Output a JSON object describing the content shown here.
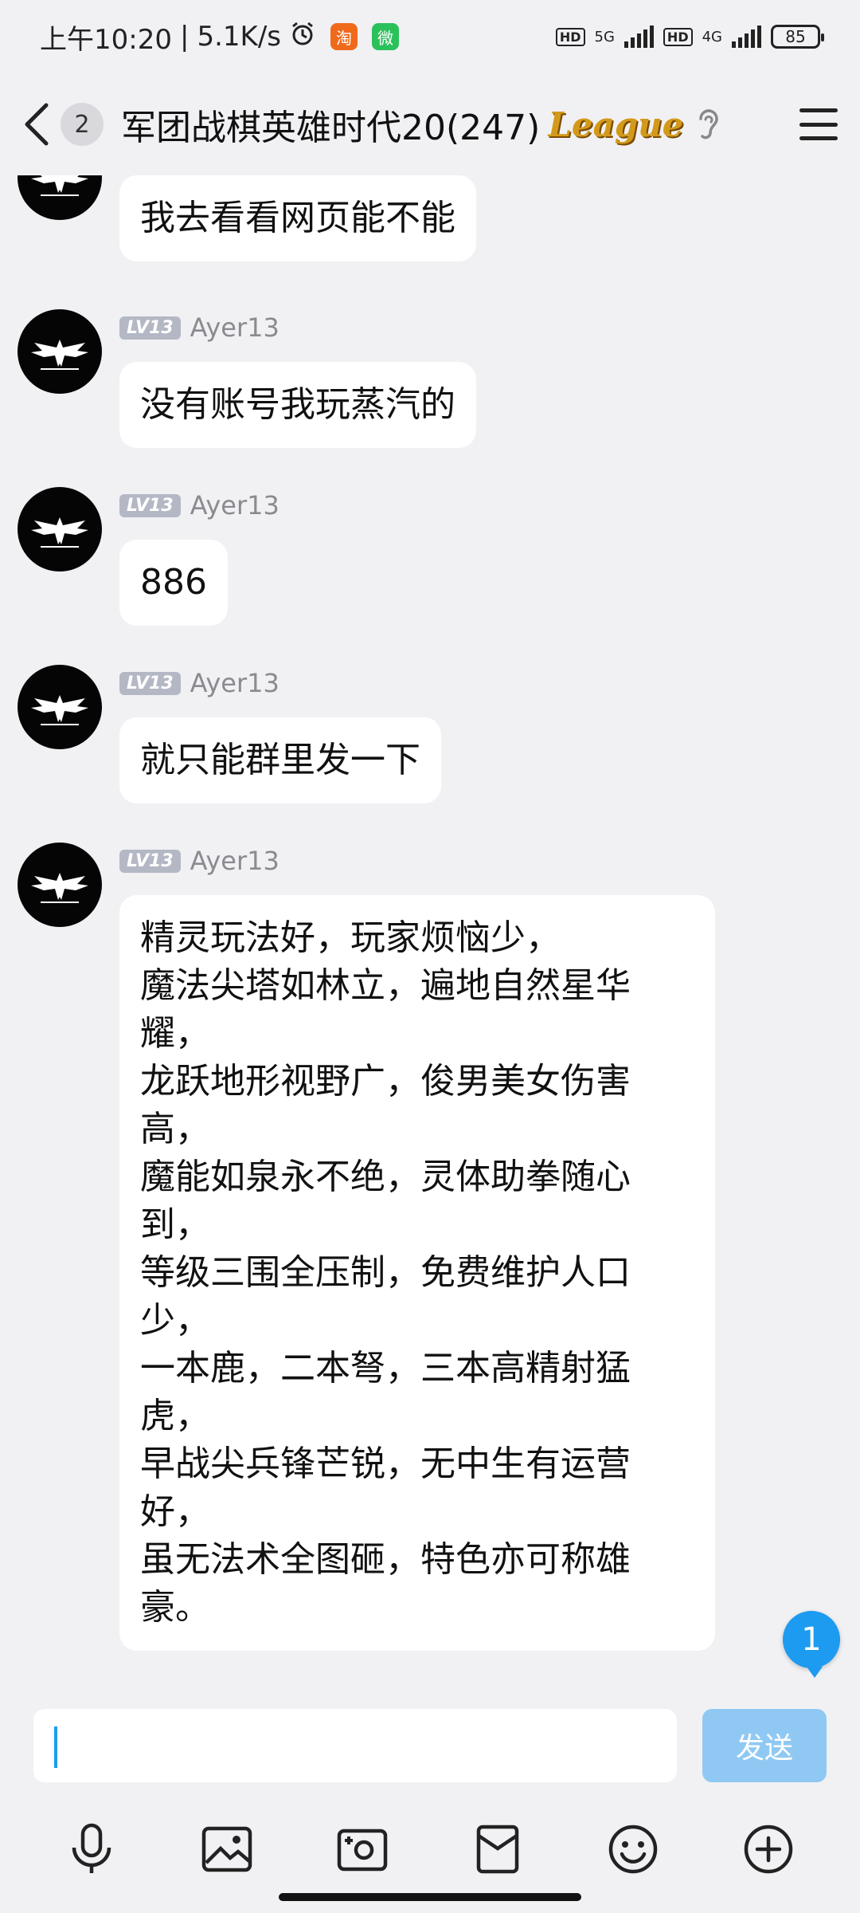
{
  "status_bar": {
    "time": "上午10:20",
    "speed": "5.1K/s",
    "app1_label": "淘",
    "app2_label": "微",
    "net1": "5G",
    "net2": "4G",
    "hd": "HD",
    "battery": "85"
  },
  "header": {
    "unread_count": "2",
    "title": "军团战棋英雄时代20(247)",
    "badge_text": "League"
  },
  "messages": [
    {
      "level": "",
      "nick": "",
      "text": "我去看看网页能不能"
    },
    {
      "level": "LV13",
      "nick": "Ayer13",
      "text": "没有账号我玩蒸汽的"
    },
    {
      "level": "LV13",
      "nick": "Ayer13",
      "text": "886"
    },
    {
      "level": "LV13",
      "nick": "Ayer13",
      "text": "就只能群里发一下"
    },
    {
      "level": "LV13",
      "nick": "Ayer13",
      "text": "精灵玩法好，玩家烦恼少，\n魔法尖塔如林立，遍地自然星华\n耀，\n龙跃地形视野广，俊男美女伤害\n高，\n魔能如泉永不绝，灵体助拳随心\n到，\n等级三围全压制，免费维护人口\n少，\n一本鹿，二本弩，三本高精射猛\n虎，\n早战尖兵锋芒锐，无中生有运营\n好，\n虽无法术全图砸，特色亦可称雄\n豪。"
    }
  ],
  "floating_badge": "1",
  "input": {
    "value": "",
    "send_label": "发送"
  },
  "toolbar_icons": [
    "microphone-icon",
    "image-icon",
    "camera-icon",
    "red-packet-icon",
    "emoji-icon",
    "plus-icon"
  ],
  "colors": {
    "accent": "#1c9bf0",
    "send_disabled": "#8fc9f3",
    "background": "#f1f1f4",
    "bubble": "#ffffff"
  }
}
